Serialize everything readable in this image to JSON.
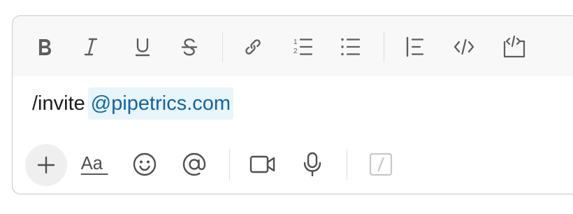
{
  "composer": {
    "toolbar": {
      "buttons": [
        {
          "name": "bold",
          "icon": "bold-icon"
        },
        {
          "name": "italic",
          "icon": "italic-icon"
        },
        {
          "name": "underline",
          "icon": "underline-icon"
        },
        {
          "name": "strikethrough",
          "icon": "strikethrough-icon"
        },
        {
          "name": "link",
          "icon": "link-icon"
        },
        {
          "name": "ordered-list",
          "icon": "ordered-list-icon"
        },
        {
          "name": "bulleted-list",
          "icon": "bulleted-list-icon"
        },
        {
          "name": "blockquote",
          "icon": "blockquote-icon"
        },
        {
          "name": "code",
          "icon": "code-icon"
        },
        {
          "name": "code-block",
          "icon": "code-block-icon"
        }
      ]
    },
    "message": {
      "command": "/invite",
      "mention": "@pipetrics.com"
    },
    "bottom_bar": {
      "buttons": [
        {
          "name": "attach",
          "icon": "plus-icon"
        },
        {
          "name": "formatting",
          "icon": "text-format-icon",
          "label": "Aa"
        },
        {
          "name": "emoji",
          "icon": "emoji-icon"
        },
        {
          "name": "mention",
          "icon": "at-sign-icon"
        },
        {
          "name": "video",
          "icon": "video-camera-icon"
        },
        {
          "name": "audio",
          "icon": "microphone-icon"
        },
        {
          "name": "shortcuts",
          "icon": "slash-command-icon"
        }
      ]
    },
    "colors": {
      "toolbar_bg": "#f8f8f8",
      "icon": "#5d5d5d",
      "mention_bg": "#e8f5fa",
      "mention_text": "#1264a3",
      "border": "#c9c9c9"
    }
  }
}
